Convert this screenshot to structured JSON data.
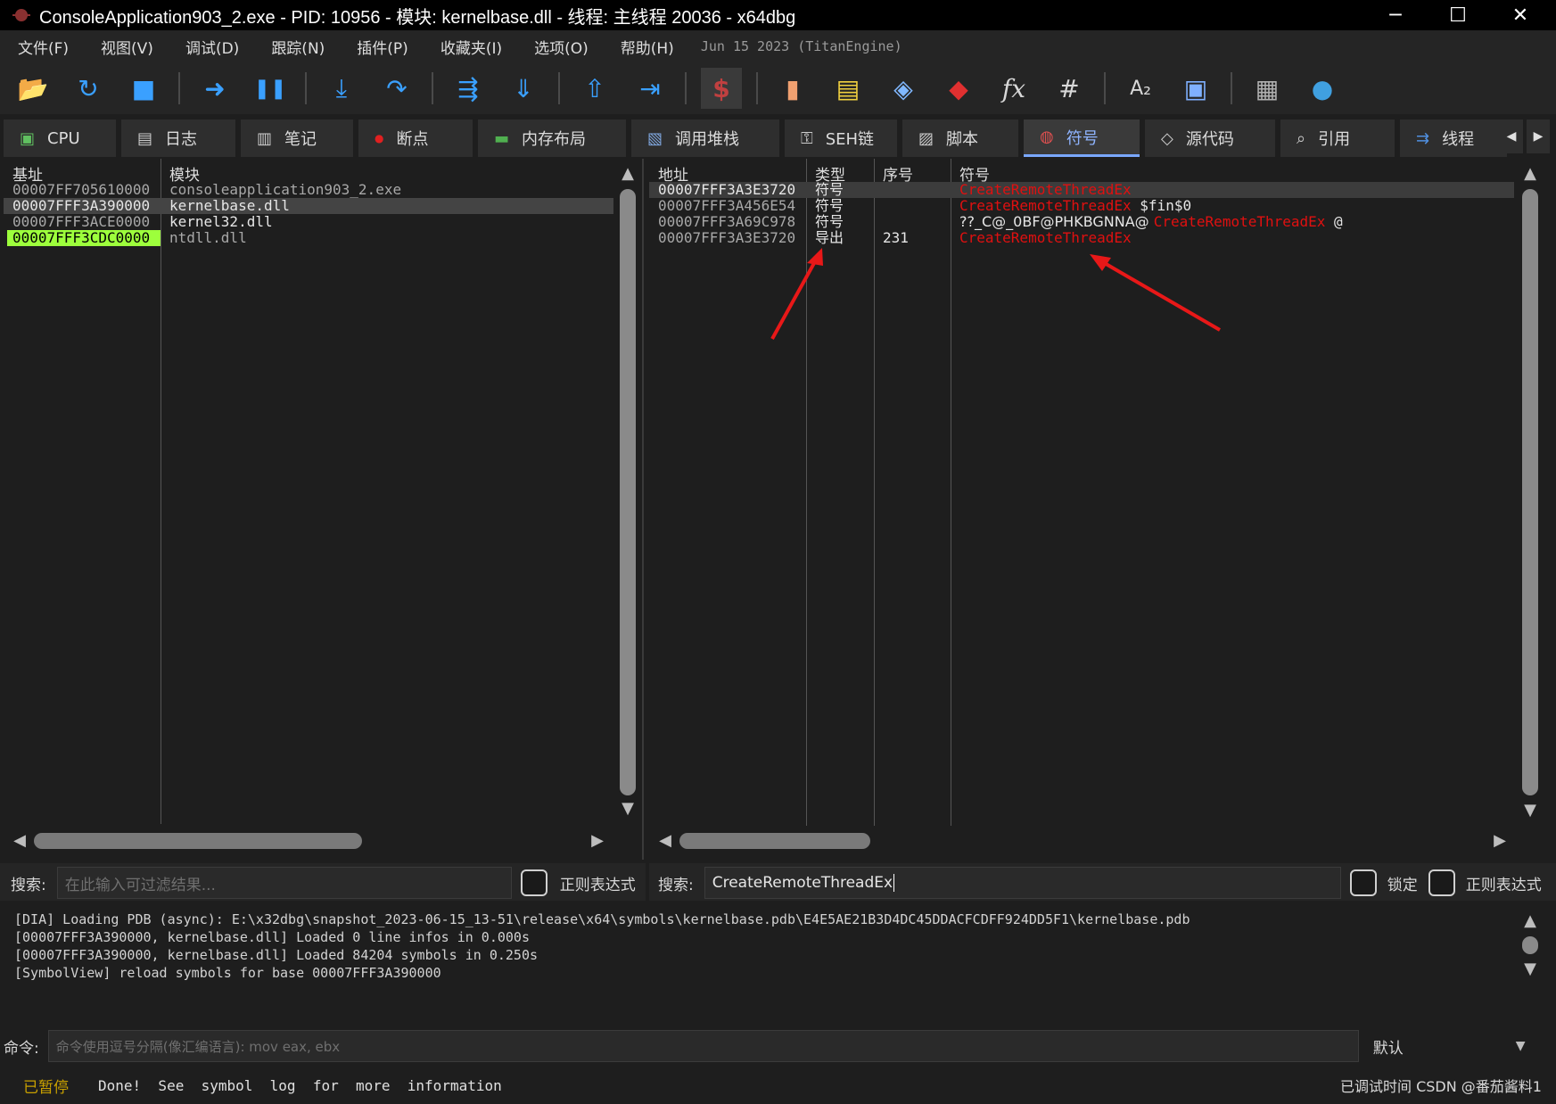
{
  "window": {
    "title": "ConsoleApplication903_2.exe - PID: 10956 - 模块: kernelbase.dll - 线程: 主线程 20036 - x64dbg",
    "minimize": "─",
    "maximize": "☐",
    "close": "✕"
  },
  "menu": {
    "items": [
      "文件(F)",
      "视图(V)",
      "调试(D)",
      "跟踪(N)",
      "插件(P)",
      "收藏夹(I)",
      "选项(O)",
      "帮助(H)"
    ],
    "version": "Jun 15 2023 (TitanEngine)"
  },
  "toolbar": {
    "icons": [
      "open-folder-icon",
      "restart-icon",
      "stop-icon",
      "run-icon",
      "pause-icon",
      "step-into-icon",
      "step-over-icon",
      "trace-into-icon",
      "trace-over-icon",
      "execute-till-return-icon",
      "run-to-user-code-icon",
      "scylla-icon",
      "patch-icon",
      "comments-icon",
      "labels-icon",
      "bookmarks-icon",
      "functions-icon",
      "hash-icon",
      "font-size-icon",
      "device-icon",
      "calculator-icon",
      "globe-icon"
    ],
    "glyphs": [
      "📂",
      "↻",
      "■",
      "➜",
      "❚❚",
      "⤓",
      "↷",
      "⇶",
      "⇓",
      "⇧",
      "⇥",
      "$",
      "▮",
      "▤",
      "◈",
      "◆",
      "fx",
      "#",
      "A₂",
      "▣",
      "▦",
      "●"
    ]
  },
  "tabs": [
    {
      "label": "CPU",
      "icon": "▣",
      "active": false
    },
    {
      "label": "日志",
      "icon": "▤",
      "active": false
    },
    {
      "label": "笔记",
      "icon": "▥",
      "active": false
    },
    {
      "label": "断点",
      "icon": "●",
      "active": false
    },
    {
      "label": "内存布局",
      "icon": "▬",
      "active": false
    },
    {
      "label": "调用堆栈",
      "icon": "▧",
      "active": false
    },
    {
      "label": "SEH链",
      "icon": "⚿",
      "active": false
    },
    {
      "label": "脚本",
      "icon": "▨",
      "active": false
    },
    {
      "label": "符号",
      "icon": "◍",
      "active": true
    },
    {
      "label": "源代码",
      "icon": "◇",
      "active": false
    },
    {
      "label": "引用",
      "icon": "⌕",
      "active": false
    },
    {
      "label": "线程",
      "icon": "⇉",
      "active": false
    }
  ],
  "modules": {
    "headers": {
      "base": "基址",
      "module": "模块"
    },
    "rows": [
      {
        "base": "00007FF705610000",
        "module": "consoleapplication903_2.exe",
        "selected": false,
        "highlight": false
      },
      {
        "base": "00007FFF3A390000",
        "module": "kernelbase.dll",
        "selected": true,
        "highlight": false
      },
      {
        "base": "00007FFF3ACE0000",
        "module": "kernel32.dll",
        "selected": false,
        "highlight": false
      },
      {
        "base": "00007FFF3CDC0000",
        "module": "ntdll.dll",
        "selected": false,
        "highlight": true
      }
    ],
    "search_label": "搜索:",
    "search_placeholder": "在此输入可过滤结果...",
    "regex_label": "正则表达式"
  },
  "symbols": {
    "headers": {
      "address": "地址",
      "type": "类型",
      "ordinal": "序号",
      "symbol": "符号"
    },
    "rows": [
      {
        "address": "00007FFF3A3E3720",
        "type": "符号",
        "ordinal": "",
        "pre": "",
        "name": "CreateRemoteThreadEx",
        "post": ""
      },
      {
        "address": "00007FFF3A456E54",
        "type": "符号",
        "ordinal": "",
        "pre": "",
        "name": "CreateRemoteThreadEx",
        "post": " $fin$0"
      },
      {
        "address": "00007FFF3A69C978",
        "type": "符号",
        "ordinal": "",
        "pre": "??_C@_0BF@PHKBGNNA@ ",
        "name": "CreateRemoteThreadEx",
        "post": " @"
      },
      {
        "address": "00007FFF3A3E3720",
        "type": "导出",
        "ordinal": "231",
        "pre": "",
        "name": "CreateRemoteThreadEx",
        "post": ""
      }
    ],
    "search_label": "搜索:",
    "search_value": "CreateRemoteThreadEx",
    "lock_label": "锁定",
    "regex_label": "正则表达式"
  },
  "log": {
    "lines": [
      "[DIA] Loading PDB (async): E:\\x32dbg\\snapshot_2023-06-15_13-51\\release\\x64\\symbols\\kernelbase.pdb\\E4E5AE21B3D4DC45DDACFCDFF924DD5F1\\kernelbase.pdb",
      "[00007FFF3A390000, kernelbase.dll] Loaded 0 line infos in 0.000s",
      "[00007FFF3A390000, kernelbase.dll] Loaded 84204 symbols in 0.250s",
      "[SymbolView] reload symbols for base 00007FFF3A390000"
    ]
  },
  "command": {
    "label": "命令:",
    "placeholder": "命令使用逗号分隔(像汇编语言): mov eax, ebx",
    "mode": "默认"
  },
  "status": {
    "state": "已暂停",
    "message": "Done!  See  symbol  log  for  more  information",
    "right": "已调试时间  CSDN @番茄酱料1"
  },
  "colors": {
    "symbol_red": "#e01010",
    "highlight_green": "#9dff3c",
    "active_tab": "#8fb4ff",
    "paused": "#c8a000"
  }
}
